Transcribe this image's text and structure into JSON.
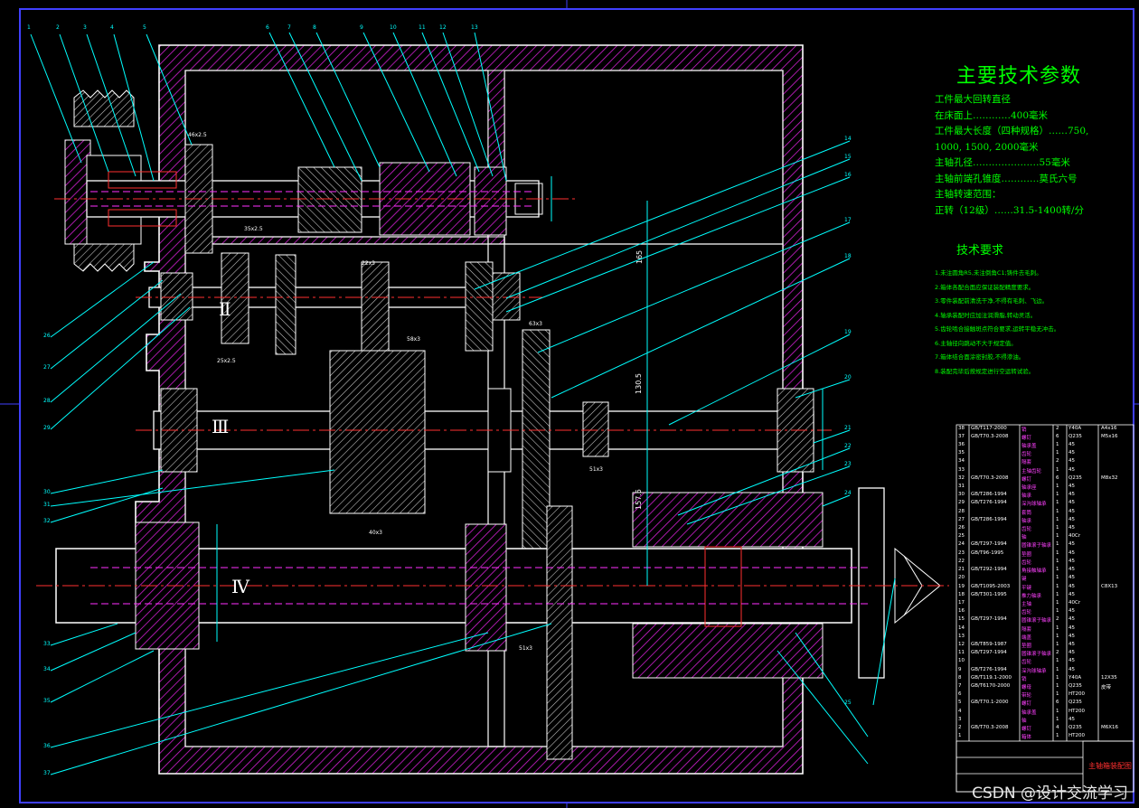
{
  "drawing": {
    "main_params": {
      "title": "主要技术参数",
      "lines": [
        "工件最大回转直径",
        "在床面上…………400毫米",
        "工件最大长度（四种规格）……750,",
        "1000, 1500, 2000毫米",
        "主轴孔径…………………55毫米",
        "主轴前端孔锥度…………莫氏六号",
        "主轴转速范围：",
        "正转（12级）……31.5-1400转/分"
      ]
    },
    "tech_req": {
      "title": "技术要求",
      "lines": [
        "1.未注圆角R5,未注倒角C1;铸件去毛刺。",
        "2.箱体各配合面应保证装配精度要求。",
        "3.零件装配前清洗干净,不得有毛刺、飞边。",
        "4.轴承装配时应加注润滑脂,转动灵活。",
        "5.齿轮啮合接触斑点符合要求,运转平稳无冲击。",
        "6.主轴径向跳动不大于规定值。",
        "7.箱体结合面涂密封胶,不得渗油。",
        "8.装配完毕后按规定进行空运转试验。"
      ]
    },
    "shaft_labels": [
      "Ⅱ",
      "Ⅲ",
      "Ⅳ"
    ],
    "top_callouts": [
      "1",
      "2",
      "3",
      "4",
      "5",
      "6",
      "7",
      "8",
      "9",
      "10",
      "11",
      "12",
      "13"
    ],
    "right_callouts": [
      "14",
      "15",
      "16",
      "17",
      "18",
      "19",
      "20",
      "21",
      "22",
      "23",
      "24",
      "25"
    ],
    "left_callouts": [
      "26",
      "27",
      "28",
      "29",
      "30",
      "31",
      "32",
      "33",
      "34",
      "35",
      "36",
      "37"
    ],
    "dim_labels": {
      "vertical_1": "165",
      "vertical_2": "130.5",
      "vertical_3": "157.5",
      "gear_1": "46x2.5",
      "gear_2": "25x2.5",
      "gear_3": "40x3",
      "gear_4": "22x3",
      "gear_5": "51x3",
      "gear_6": "63x3",
      "gear_7": "58x3",
      "gear_8": "35x2.5",
      "gear_9": "51x3"
    },
    "bom": {
      "rows": [
        [
          "38",
          "GB/T117-2000",
          "销",
          "2",
          "Y40A",
          "A4x16"
        ],
        [
          "37",
          "GB/T70.3-2008",
          "螺钉",
          "6",
          "Q235",
          "M5x16"
        ],
        [
          "36",
          "",
          "轴承盖",
          "1",
          "45",
          ""
        ],
        [
          "35",
          "",
          "齿轮",
          "1",
          "45",
          ""
        ],
        [
          "34",
          "",
          "隔套",
          "2",
          "45",
          ""
        ],
        [
          "33",
          "",
          "主轴齿轮",
          "1",
          "45",
          ""
        ],
        [
          "32",
          "GB/T70.3-2008",
          "螺钉",
          "6",
          "Q235",
          "M8x32"
        ],
        [
          "31",
          "",
          "轴承座",
          "1",
          "45",
          ""
        ],
        [
          "30",
          "GB/T286-1994",
          "轴承",
          "1",
          "45",
          ""
        ],
        [
          "29",
          "GB/T276-1994",
          "深沟球轴承",
          "1",
          "45",
          ""
        ],
        [
          "28",
          "",
          "套筒",
          "1",
          "45",
          ""
        ],
        [
          "27",
          "GB/T286-1994",
          "轴承",
          "1",
          "45",
          ""
        ],
        [
          "26",
          "",
          "齿轮",
          "1",
          "45",
          ""
        ],
        [
          "25",
          "",
          "轴",
          "1",
          "40Cr",
          ""
        ],
        [
          "24",
          "GB/T297-1994",
          "圆锥滚子轴承",
          "1",
          "45",
          ""
        ],
        [
          "23",
          "GB/T96-1995",
          "垫圈",
          "1",
          "45",
          ""
        ],
        [
          "22",
          "",
          "齿轮",
          "1",
          "45",
          ""
        ],
        [
          "21",
          "GB/T292-1994",
          "角接触轴承",
          "1",
          "45",
          ""
        ],
        [
          "20",
          "",
          "键",
          "1",
          "45",
          ""
        ],
        [
          "19",
          "GB/T1095-2003",
          "平键",
          "1",
          "45",
          "C8X13"
        ],
        [
          "18",
          "GB/T301-1995",
          "推力轴承",
          "1",
          "45",
          ""
        ],
        [
          "17",
          "",
          "主轴",
          "1",
          "40Cr",
          ""
        ],
        [
          "16",
          "",
          "齿轮",
          "1",
          "45",
          ""
        ],
        [
          "15",
          "GB/T297-1994",
          "圆锥滚子轴承",
          "2",
          "45",
          ""
        ],
        [
          "14",
          "",
          "隔套",
          "1",
          "45",
          ""
        ],
        [
          "13",
          "",
          "端盖",
          "1",
          "45",
          ""
        ],
        [
          "12",
          "GB/T859-1987",
          "垫圈",
          "1",
          "45",
          ""
        ],
        [
          "11",
          "GB/T297-1994",
          "圆锥滚子轴承",
          "2",
          "45",
          ""
        ],
        [
          "10",
          "",
          "齿轮",
          "1",
          "45",
          ""
        ],
        [
          "9",
          "GB/T276-1994",
          "深沟球轴承",
          "1",
          "45",
          ""
        ],
        [
          "8",
          "GB/T119.1-2000",
          "销",
          "1",
          "Y40A",
          "12X35"
        ],
        [
          "7",
          "GB/T6170-2000",
          "螺母",
          "1",
          "Q235",
          "皮带"
        ],
        [
          "6",
          "",
          "带轮",
          "1",
          "HT200",
          ""
        ],
        [
          "5",
          "GB/T70.1-2000",
          "螺钉",
          "6",
          "Q235",
          ""
        ],
        [
          "4",
          "",
          "轴承盖",
          "1",
          "HT200",
          ""
        ],
        [
          "3",
          "",
          "轴",
          "1",
          "45",
          ""
        ],
        [
          "2",
          "GB/T70.3-2008",
          "螺钉",
          "4",
          "Q235",
          "M6X16"
        ],
        [
          "1",
          "",
          "箱体",
          "1",
          "HT200",
          ""
        ]
      ],
      "title_name": "主轴箱装配图"
    },
    "watermark": "CSDN @设计交流学习"
  }
}
